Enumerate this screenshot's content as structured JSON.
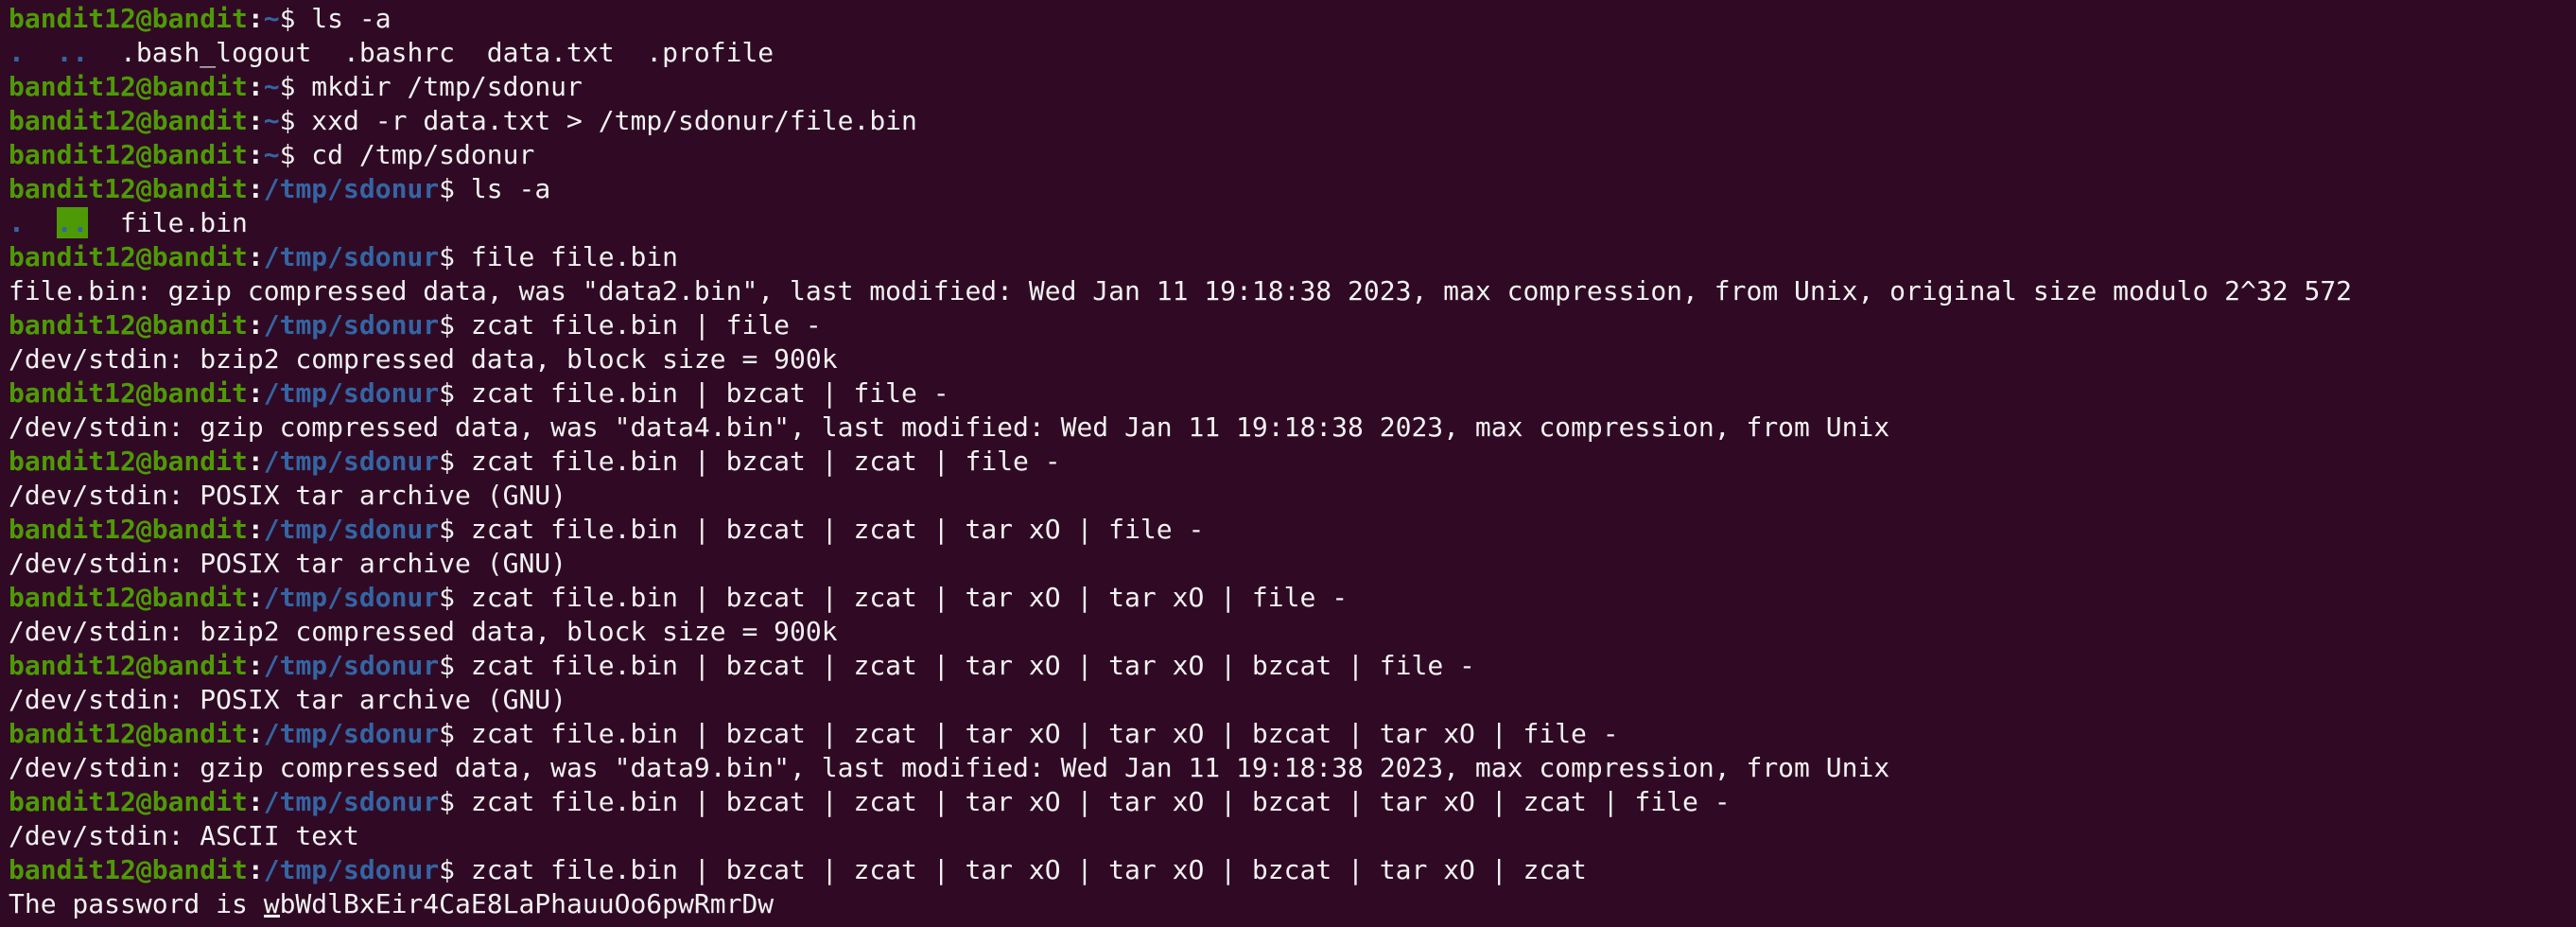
{
  "colors": {
    "background": "#300a24",
    "prompt_user": "#4e9a06",
    "prompt_path": "#3465a4",
    "text": "#f2f2f2"
  },
  "prompt": {
    "user_host": "bandit12@bandit",
    "sep": ":",
    "dollar": "$"
  },
  "lines": [
    {
      "type": "prompt",
      "path": "~",
      "cmd": " ls -a"
    },
    {
      "type": "listing",
      "items": [
        {
          "text": ".",
          "kind": "dir"
        },
        {
          "text": "  ",
          "kind": "plain"
        },
        {
          "text": "..",
          "kind": "dir"
        },
        {
          "text": "  .bash_logout  .bashrc  data.txt  .profile",
          "kind": "plain"
        }
      ]
    },
    {
      "type": "prompt",
      "path": "~",
      "cmd": " mkdir /tmp/sdonur"
    },
    {
      "type": "prompt",
      "path": "~",
      "cmd": " xxd -r data.txt > /tmp/sdonur/file.bin"
    },
    {
      "type": "prompt",
      "path": "~",
      "cmd": " cd /tmp/sdonur"
    },
    {
      "type": "prompt",
      "path": "/tmp/sdonur",
      "cmd": " ls -a"
    },
    {
      "type": "listing",
      "items": [
        {
          "text": ".",
          "kind": "dir"
        },
        {
          "text": "  ",
          "kind": "plain"
        },
        {
          "text": "..",
          "kind": "dirhl"
        },
        {
          "text": "  file.bin",
          "kind": "plain"
        }
      ]
    },
    {
      "type": "prompt",
      "path": "/tmp/sdonur",
      "cmd": " file file.bin"
    },
    {
      "type": "output",
      "text": "file.bin: gzip compressed data, was \"data2.bin\", last modified: Wed Jan 11 19:18:38 2023, max compression, from Unix, original size modulo 2^32 572"
    },
    {
      "type": "prompt",
      "path": "/tmp/sdonur",
      "cmd": " zcat file.bin | file -"
    },
    {
      "type": "output",
      "text": "/dev/stdin: bzip2 compressed data, block size = 900k"
    },
    {
      "type": "prompt",
      "path": "/tmp/sdonur",
      "cmd": " zcat file.bin | bzcat | file -"
    },
    {
      "type": "output",
      "text": "/dev/stdin: gzip compressed data, was \"data4.bin\", last modified: Wed Jan 11 19:18:38 2023, max compression, from Unix"
    },
    {
      "type": "prompt",
      "path": "/tmp/sdonur",
      "cmd": " zcat file.bin | bzcat | zcat | file -"
    },
    {
      "type": "output",
      "text": "/dev/stdin: POSIX tar archive (GNU)"
    },
    {
      "type": "prompt",
      "path": "/tmp/sdonur",
      "cmd": " zcat file.bin | bzcat | zcat | tar xO | file -"
    },
    {
      "type": "output",
      "text": "/dev/stdin: POSIX tar archive (GNU)"
    },
    {
      "type": "prompt",
      "path": "/tmp/sdonur",
      "cmd": " zcat file.bin | bzcat | zcat | tar xO | tar xO | file -"
    },
    {
      "type": "output",
      "text": "/dev/stdin: bzip2 compressed data, block size = 900k"
    },
    {
      "type": "prompt",
      "path": "/tmp/sdonur",
      "cmd": " zcat file.bin | bzcat | zcat | tar xO | tar xO | bzcat | file -"
    },
    {
      "type": "output",
      "text": "/dev/stdin: POSIX tar archive (GNU)"
    },
    {
      "type": "prompt",
      "path": "/tmp/sdonur",
      "cmd": " zcat file.bin | bzcat | zcat | tar xO | tar xO | bzcat | tar xO | file -"
    },
    {
      "type": "output",
      "text": "/dev/stdin: gzip compressed data, was \"data9.bin\", last modified: Wed Jan 11 19:18:38 2023, max compression, from Unix"
    },
    {
      "type": "prompt",
      "path": "/tmp/sdonur",
      "cmd": " zcat file.bin | bzcat | zcat | tar xO | tar xO | bzcat | tar xO | zcat | file -"
    },
    {
      "type": "output",
      "text": "/dev/stdin: ASCII text"
    },
    {
      "type": "prompt",
      "path": "/tmp/sdonur",
      "cmd": " zcat file.bin | bzcat | zcat | tar xO | tar xO | bzcat | tar xO | zcat"
    },
    {
      "type": "output",
      "text": "The password is wbWdlBxEir4CaE8LaPhauuOo6pwRmrDw",
      "cursor": true
    }
  ]
}
